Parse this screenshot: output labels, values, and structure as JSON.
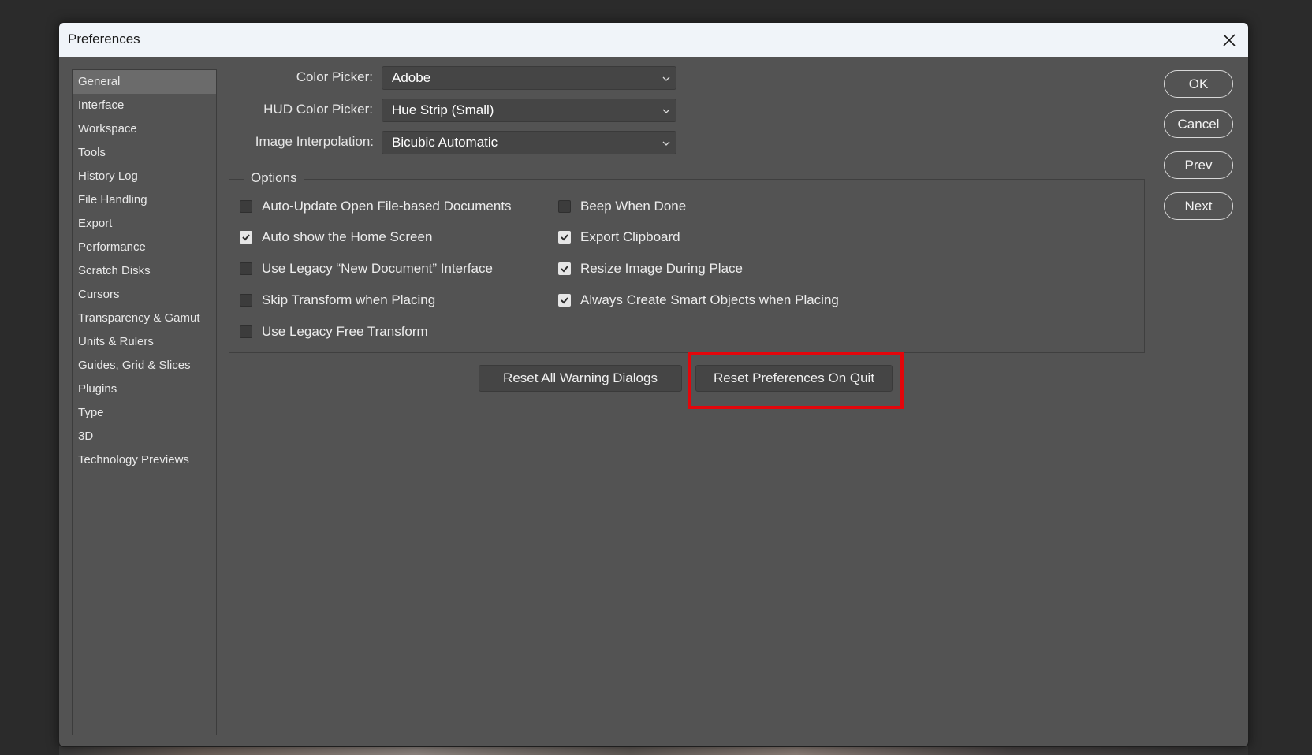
{
  "dialog": {
    "title": "Preferences"
  },
  "sidebar": {
    "items": [
      {
        "label": "General"
      },
      {
        "label": "Interface"
      },
      {
        "label": "Workspace"
      },
      {
        "label": "Tools"
      },
      {
        "label": "History Log"
      },
      {
        "label": "File Handling"
      },
      {
        "label": "Export"
      },
      {
        "label": "Performance"
      },
      {
        "label": "Scratch Disks"
      },
      {
        "label": "Cursors"
      },
      {
        "label": "Transparency & Gamut"
      },
      {
        "label": "Units & Rulers"
      },
      {
        "label": "Guides, Grid & Slices"
      },
      {
        "label": "Plugins"
      },
      {
        "label": "Type"
      },
      {
        "label": "3D"
      },
      {
        "label": "Technology Previews"
      }
    ],
    "active": "General"
  },
  "general": {
    "color_picker": {
      "label": "Color Picker:",
      "value": "Adobe"
    },
    "hud_color_picker": {
      "label": "HUD Color Picker:",
      "value": "Hue Strip (Small)"
    },
    "image_interpolation": {
      "label": "Image Interpolation:",
      "value": "Bicubic Automatic"
    }
  },
  "options": {
    "legend": "Options",
    "left": [
      {
        "label": "Auto-Update Open File-based Documents",
        "checked": false
      },
      {
        "label": "Auto show the Home Screen",
        "checked": true
      },
      {
        "label": "Use Legacy “New Document” Interface",
        "checked": false
      },
      {
        "label": "Skip Transform when Placing",
        "checked": false
      },
      {
        "label": "Use Legacy Free Transform",
        "checked": false
      }
    ],
    "right": [
      {
        "label": "Beep When Done",
        "checked": false
      },
      {
        "label": "Export Clipboard",
        "checked": true
      },
      {
        "label": "Resize Image During Place",
        "checked": true
      },
      {
        "label": "Always Create Smart Objects when Placing",
        "checked": true
      }
    ]
  },
  "actions": {
    "reset_warnings": "Reset All Warning Dialogs",
    "reset_prefs": "Reset Preferences On Quit",
    "highlight_color": "#e3060b"
  },
  "buttons": {
    "ok": "OK",
    "cancel": "Cancel",
    "prev": "Prev",
    "next": "Next"
  }
}
